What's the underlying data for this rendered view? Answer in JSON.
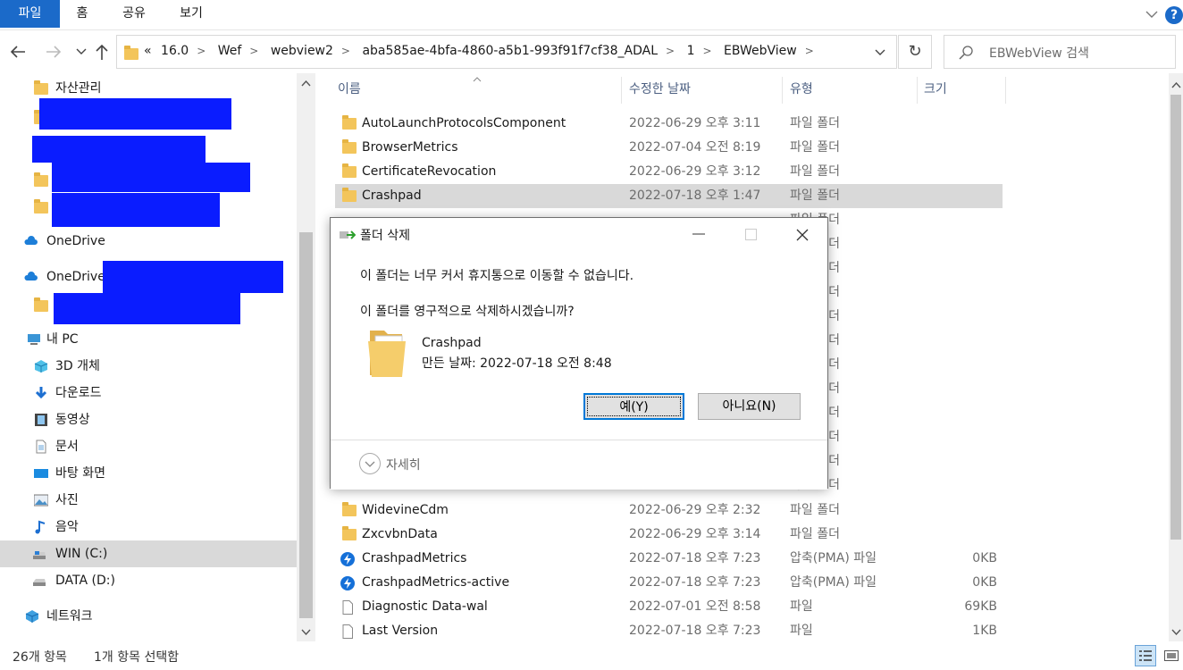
{
  "ribbon": {
    "tabs": [
      "파일",
      "홈",
      "공유",
      "보기"
    ]
  },
  "address": {
    "overflow_glyph": "«",
    "crumbs": [
      "16.0",
      "Wef",
      "webview2",
      "aba585ae-4bfa-4860-a5b1-993f91f7cf38_ADAL",
      "1",
      "EBWebView"
    ],
    "search_placeholder": "EBWebView 검색"
  },
  "nav": {
    "items": [
      {
        "label": "자산관리",
        "icon": "folder-icon"
      },
      {
        "label": "OneDrive",
        "icon": "cloud-icon"
      },
      {
        "label": "OneDrive",
        "icon": "cloud-icon"
      },
      {
        "label": "내 PC",
        "icon": "pc-icon"
      },
      {
        "label": "3D 개체",
        "icon": "cube-icon"
      },
      {
        "label": "다운로드",
        "icon": "download-icon"
      },
      {
        "label": "동영상",
        "icon": "video-icon"
      },
      {
        "label": "문서",
        "icon": "document-icon"
      },
      {
        "label": "바탕 화면",
        "icon": "desktop-icon"
      },
      {
        "label": "사진",
        "icon": "picture-icon"
      },
      {
        "label": "음악",
        "icon": "music-icon"
      },
      {
        "label": "WIN (C:)",
        "icon": "drive-icon"
      },
      {
        "label": "DATA (D:)",
        "icon": "drive-icon"
      },
      {
        "label": "네트워크",
        "icon": "network-icon"
      }
    ]
  },
  "list": {
    "columns": [
      "이름",
      "수정한 날짜",
      "유형",
      "크기"
    ],
    "rows": [
      {
        "name": "AutoLaunchProtocolsComponent",
        "date": "2022-06-29 오후 3:11",
        "type": "파일 폴더",
        "size": ""
      },
      {
        "name": "BrowserMetrics",
        "date": "2022-07-04 오전 8:19",
        "type": "파일 폴더",
        "size": ""
      },
      {
        "name": "CertificateRevocation",
        "date": "2022-06-29 오후 3:12",
        "type": "파일 폴더",
        "size": ""
      },
      {
        "name": "Crashpad",
        "date": "2022-07-18 오후 1:47",
        "type": "파일 폴더",
        "size": ""
      },
      {
        "name": "WidevineCdm",
        "date": "2022-06-29 오후 2:32",
        "type": "파일 폴더",
        "size": ""
      },
      {
        "name": "ZxcvbnData",
        "date": "2022-06-29 오후 3:14",
        "type": "파일 폴더",
        "size": ""
      },
      {
        "name": "CrashpadMetrics",
        "date": "2022-07-18 오후 7:23",
        "type": "압축(PMA) 파일",
        "size": "0KB"
      },
      {
        "name": "CrashpadMetrics-active",
        "date": "2022-07-18 오후 7:23",
        "type": "압축(PMA) 파일",
        "size": "0KB"
      },
      {
        "name": "Diagnostic Data-wal",
        "date": "2022-07-01 오전 8:58",
        "type": "파일",
        "size": "69KB"
      },
      {
        "name": "Last Version",
        "date": "2022-07-18 오후 7:23",
        "type": "파일",
        "size": "1KB"
      }
    ],
    "hidden_type_label": "파일 폴더"
  },
  "status": {
    "count": "26개 항목",
    "selected": "1개 항목 선택함"
  },
  "dialog": {
    "title": "폴더 삭제",
    "message1": "이 폴더는 너무 커서 휴지통으로 이동할 수 없습니다.",
    "message2": "이 폴더를 영구적으로 삭제하시겠습니까?",
    "item_name": "Crashpad",
    "item_created": "만든 날짜: 2022-07-18 오전 8:48",
    "yes_label": "예(Y)",
    "no_label": "아니요(N)",
    "details_label": "자세히"
  },
  "colors": {
    "accent": "#1b6ac9",
    "redaction": "#0a1cff",
    "selection": "#d9d9d9",
    "folder": "#f3c55b"
  }
}
